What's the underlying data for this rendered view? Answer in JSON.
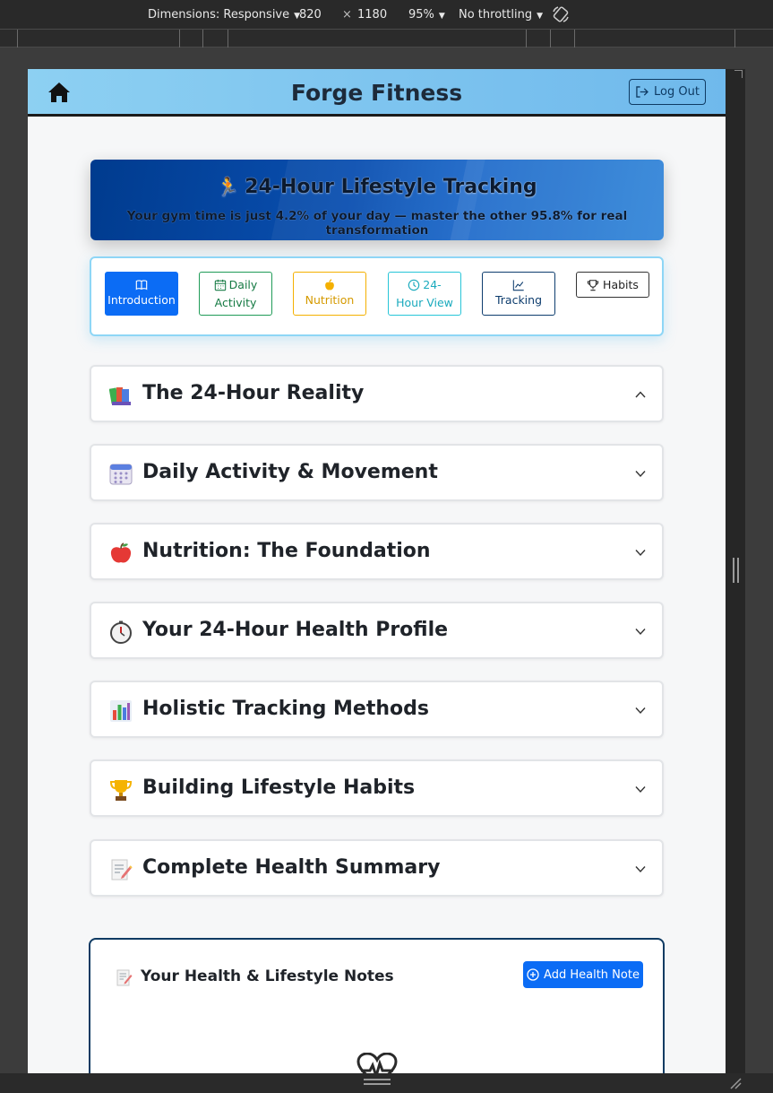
{
  "devtools": {
    "dimensions_label": "Dimensions: Responsive",
    "width": "820",
    "times": "×",
    "height": "1180",
    "zoom": "95%",
    "throttling": "No throttling"
  },
  "navbar": {
    "brand": "Forge Fitness",
    "logout_label": "Log Out"
  },
  "hero": {
    "emoji": "🏃",
    "title": "24-Hour Lifestyle Tracking",
    "subtitle": "Your gym time is just 4.2% of your day — master the other 95.8% for real transformation"
  },
  "tabs": [
    {
      "line1": "Introduction",
      "icon": "book-icon",
      "active": true
    },
    {
      "line1": "Daily",
      "line2": "Activity",
      "icon": "calendar-icon"
    },
    {
      "line1": "Nutrition",
      "icon": "apple-icon"
    },
    {
      "line1": "24-",
      "line2": "Hour View",
      "icon": "clock-icon"
    },
    {
      "line1": "Tracking",
      "icon": "chart-line-icon"
    },
    {
      "line1": "Habits",
      "icon": "trophy-icon"
    }
  ],
  "sections": [
    {
      "title": "The 24-Hour Reality",
      "icon": "books-icon",
      "expanded": true
    },
    {
      "title": "Daily Activity & Movement",
      "icon": "calendar-icon",
      "expanded": false
    },
    {
      "title": "Nutrition: The Foundation",
      "icon": "apple-icon",
      "expanded": false
    },
    {
      "title": "Your 24-Hour Health Profile",
      "icon": "stopwatch-icon",
      "expanded": false
    },
    {
      "title": "Holistic Tracking Methods",
      "icon": "bar-chart-icon",
      "expanded": false
    },
    {
      "title": "Building Lifestyle Habits",
      "icon": "trophy-icon",
      "expanded": false
    },
    {
      "title": "Complete Health Summary",
      "icon": "memo-icon",
      "expanded": false
    }
  ],
  "notes": {
    "title": "Your Health & Lifestyle Notes",
    "add_label": "Add Health Note"
  },
  "colors": {
    "primary": "#0b6cf5",
    "navbar_from": "#8dd0f2",
    "navbar_to": "#6fb9ec",
    "hero_dark": "#003b8e",
    "tab_card_border": "#8ed6f6",
    "dark_navy": "#0f3b63"
  }
}
